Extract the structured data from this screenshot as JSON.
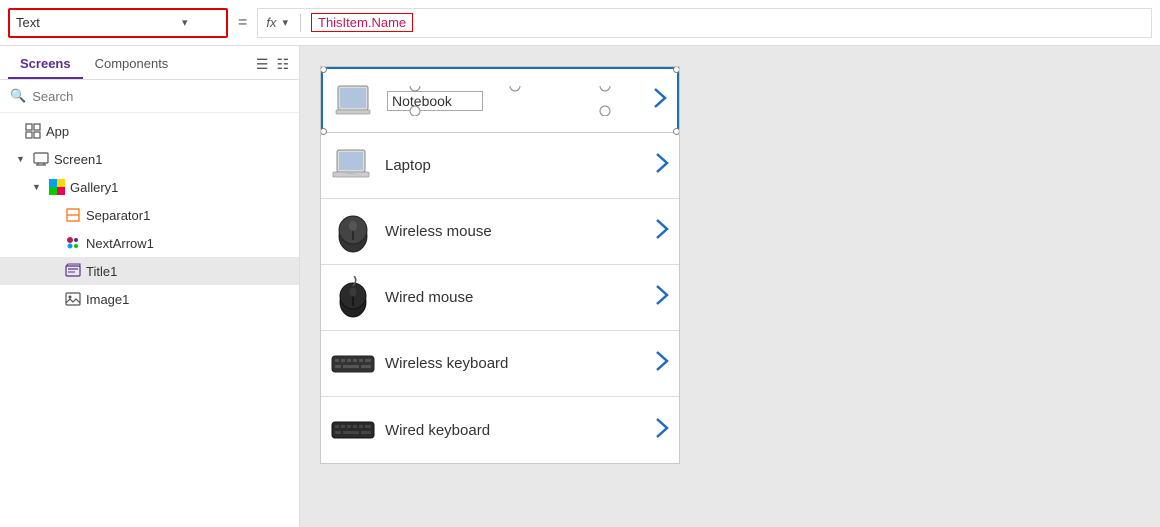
{
  "toolbar": {
    "property_label": "Text",
    "chevron": "▾",
    "equals": "=",
    "fx_label": "fx",
    "formula_value": "ThisItem.Name"
  },
  "left_panel": {
    "tabs": [
      {
        "id": "screens",
        "label": "Screens",
        "active": true
      },
      {
        "id": "components",
        "label": "Components",
        "active": false
      }
    ],
    "search_placeholder": "Search",
    "tree": [
      {
        "id": "app",
        "label": "App",
        "indent": 0,
        "expand": "",
        "icon": "app",
        "selected": false
      },
      {
        "id": "screen1",
        "label": "Screen1",
        "indent": 1,
        "expand": "▲",
        "icon": "screen",
        "selected": false
      },
      {
        "id": "gallery1",
        "label": "Gallery1",
        "indent": 2,
        "expand": "▲",
        "icon": "gallery",
        "selected": false
      },
      {
        "id": "separator1",
        "label": "Separator1",
        "indent": 3,
        "expand": "",
        "icon": "separator",
        "selected": false
      },
      {
        "id": "nextarrow1",
        "label": "NextArrow1",
        "indent": 3,
        "expand": "",
        "icon": "nextarrow",
        "selected": false
      },
      {
        "id": "title1",
        "label": "Title1",
        "indent": 3,
        "expand": "",
        "icon": "title",
        "selected": true
      },
      {
        "id": "image1",
        "label": "Image1",
        "indent": 3,
        "expand": "",
        "icon": "image",
        "selected": false
      }
    ]
  },
  "gallery": {
    "items": [
      {
        "id": "notebook",
        "label": "Notebook",
        "image_type": "notebook",
        "selected": true
      },
      {
        "id": "laptop",
        "label": "Laptop",
        "image_type": "laptop",
        "selected": false
      },
      {
        "id": "wireless_mouse",
        "label": "Wireless mouse",
        "image_type": "wireless_mouse",
        "selected": false
      },
      {
        "id": "wired_mouse",
        "label": "Wired mouse",
        "image_type": "wired_mouse",
        "selected": false
      },
      {
        "id": "wireless_keyboard",
        "label": "Wireless keyboard",
        "image_type": "wireless_keyboard",
        "selected": false
      },
      {
        "id": "wired_keyboard",
        "label": "Wired keyboard",
        "image_type": "wired_keyboard",
        "selected": false
      }
    ]
  }
}
